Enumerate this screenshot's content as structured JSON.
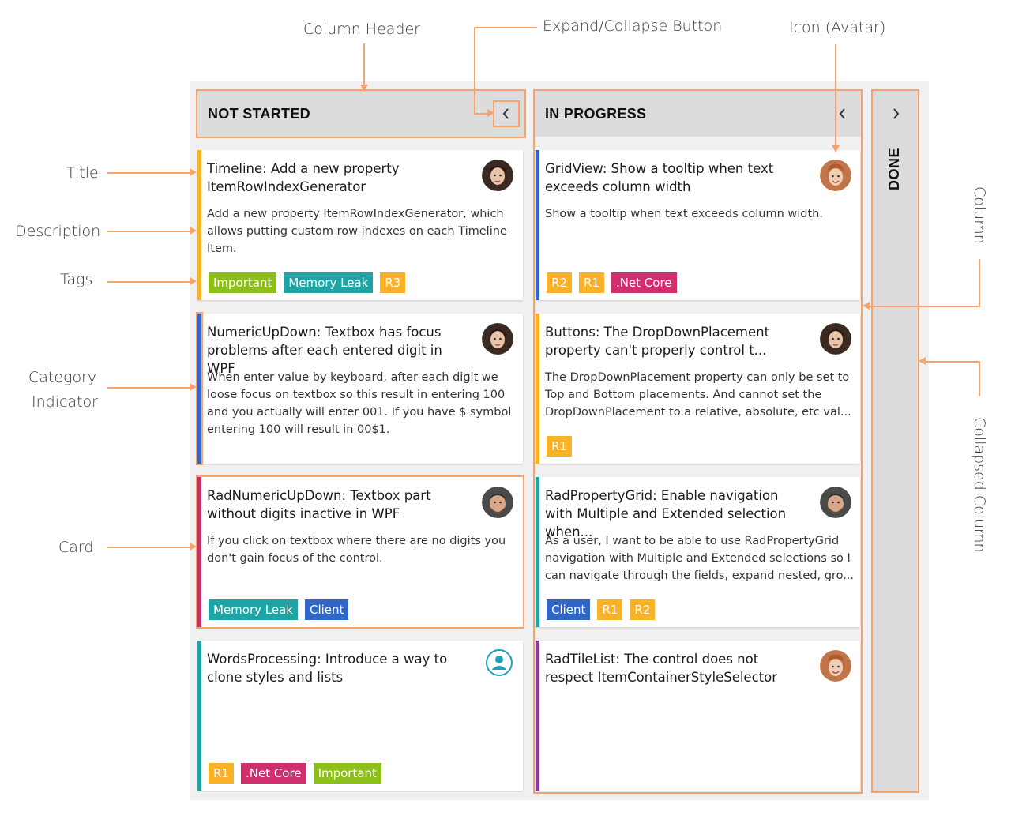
{
  "annotations": {
    "column_header": "Column Header",
    "expand_collapse_button": "Expand/Collapse Button",
    "icon_avatar": "Icon (Avatar)",
    "title": "Title",
    "description": "Description",
    "tags": "Tags",
    "category_indicator_line1": "Category",
    "category_indicator_line2": "Indicator",
    "card": "Card",
    "column": "Column",
    "collapsed_column": "Collapsed Column"
  },
  "colors": {
    "annotation_line": "#f5a26b",
    "important": "#8cbf17",
    "memory_leak": "#1ea4a4",
    "release": "#fbb125",
    "net_core": "#d12e6e",
    "client": "#3067c6",
    "indicator_yellow": "#fbb125",
    "indicator_blue": "#3067c6",
    "indicator_magenta": "#c2306b",
    "indicator_teal": "#1ea4a4",
    "indicator_purple": "#7d3fa8"
  },
  "columns": [
    {
      "title": "NOT STARTED",
      "button_icon": "chevron-left-icon",
      "button_glyph": "‹",
      "cards": [
        {
          "title": "Timeline: Add a new property ItemRowIndexGenerator",
          "description": "Add a new property ItemRowIndexGenerator, which allows putting custom row indexes on each Timeline Item.",
          "avatar": "female-avatar-icon",
          "tags": [
            "Important",
            "Memory Leak",
            "R3"
          ]
        },
        {
          "title": "NumericUpDown: Textbox has focus problems after each entered digit in WPF",
          "description": "When enter value by keyboard, after each digit we loose focus on textbox so this result in entering 100 and you actually will enter 001. If you have $ symbol entering 100 will result in 00$1.",
          "avatar": "female-avatar-icon",
          "tags": []
        },
        {
          "title": "RadNumericUpDown: Textbox part without digits inactive in WPF",
          "description": "If you click on textbox where there are no digits you don't gain focus of the control.",
          "avatar": "male-avatar-icon",
          "tags": [
            "Memory Leak",
            "Client"
          ]
        },
        {
          "title": "WordsProcessing: Introduce a way to clone styles and lists",
          "description": "",
          "avatar": "user-placeholder-icon",
          "tags": [
            "R1",
            ".Net Core",
            "Important"
          ]
        }
      ]
    },
    {
      "title": "IN PROGRESS",
      "button_icon": "chevron-left-icon",
      "button_glyph": "‹",
      "cards": [
        {
          "title": "GridView: Show a tooltip when text exceeds column width",
          "description": "Show a tooltip when text exceeds column width.",
          "avatar": "female-avatar-icon",
          "tags": [
            "R2",
            "R1",
            ".Net Core"
          ]
        },
        {
          "title": "Buttons: The DropDownPlacement property can't properly control t...",
          "description": "The DropDownPlacement property can only be set to Top and Bottom placements. And cannot set the DropDownPlacement to a relative, absolute, etc val...",
          "avatar": "female-avatar-icon",
          "tags": [
            "R1"
          ]
        },
        {
          "title": "RadPropertyGrid: Enable navigation with Multiple and Extended selection when...",
          "description": "As a user, I want to be able to use RadPropertyGrid navigation with Multiple and Extended selections so I can navigate through the fields, expand nested, gro...",
          "avatar": "male-avatar-icon",
          "tags": [
            "Client",
            "R1",
            "R2"
          ]
        },
        {
          "title": "RadTileList: The control does not respect ItemContainerStyleSelector",
          "description": "",
          "avatar": "female-avatar-icon",
          "tags": []
        }
      ]
    },
    {
      "title": "DONE",
      "button_icon": "chevron-right-icon",
      "button_glyph": "›"
    }
  ]
}
